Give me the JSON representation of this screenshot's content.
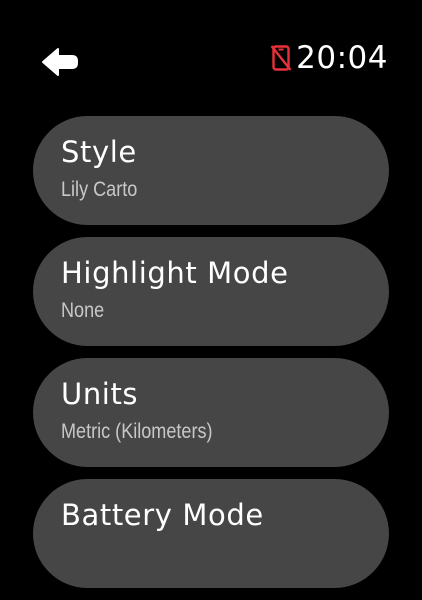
{
  "header": {
    "back_icon": "arrow-left-icon",
    "status": {
      "phone_icon": "phone-disconnected-icon",
      "phone_icon_color": "#e8323a",
      "time": "20:04"
    }
  },
  "settings": {
    "items": [
      {
        "title": "Style",
        "value": "Lily Carto"
      },
      {
        "title": "Highlight Mode",
        "value": "None"
      },
      {
        "title": "Units",
        "value": "Metric (Kilometers)"
      },
      {
        "title": "Battery Mode",
        "value": ""
      }
    ]
  },
  "colors": {
    "background": "#000000",
    "item_background": "#464646",
    "title_text": "#ffffff",
    "value_text": "#c8c8c8"
  }
}
